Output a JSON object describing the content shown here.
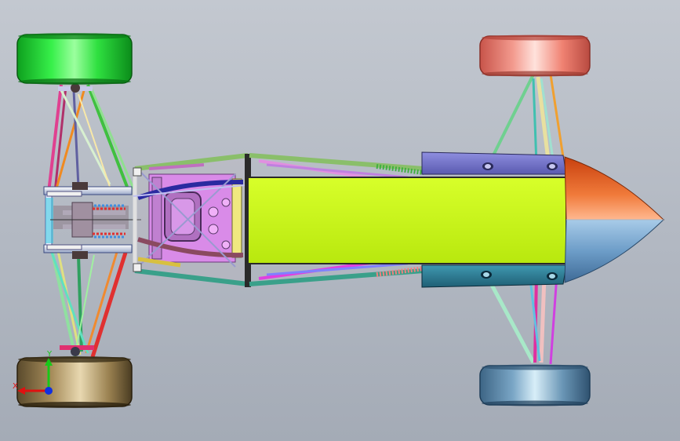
{
  "viewport": {
    "background_top": "#c3c8d0",
    "background_bottom": "#a4abb6"
  },
  "tires": {
    "rear_left_color": "#19e02c",
    "rear_right_color": "#b8a06c",
    "front_left_color": "#f0857a",
    "front_right_color": "#6e9bbb"
  },
  "body": {
    "cockpit_panel_color": "#c8f51a",
    "nose_upper_color": "#e8602a",
    "nose_lower_color": "#6d9dc8",
    "side_pod_upper_color": "#7777c8",
    "side_pod_lower_color": "#2e7d93",
    "engine_color": "#d98be8"
  },
  "triad": {
    "y_label": "Y",
    "x_label": "X",
    "y_color": "#18c818",
    "x_color": "#e01010",
    "z_color": "#1030e0"
  }
}
